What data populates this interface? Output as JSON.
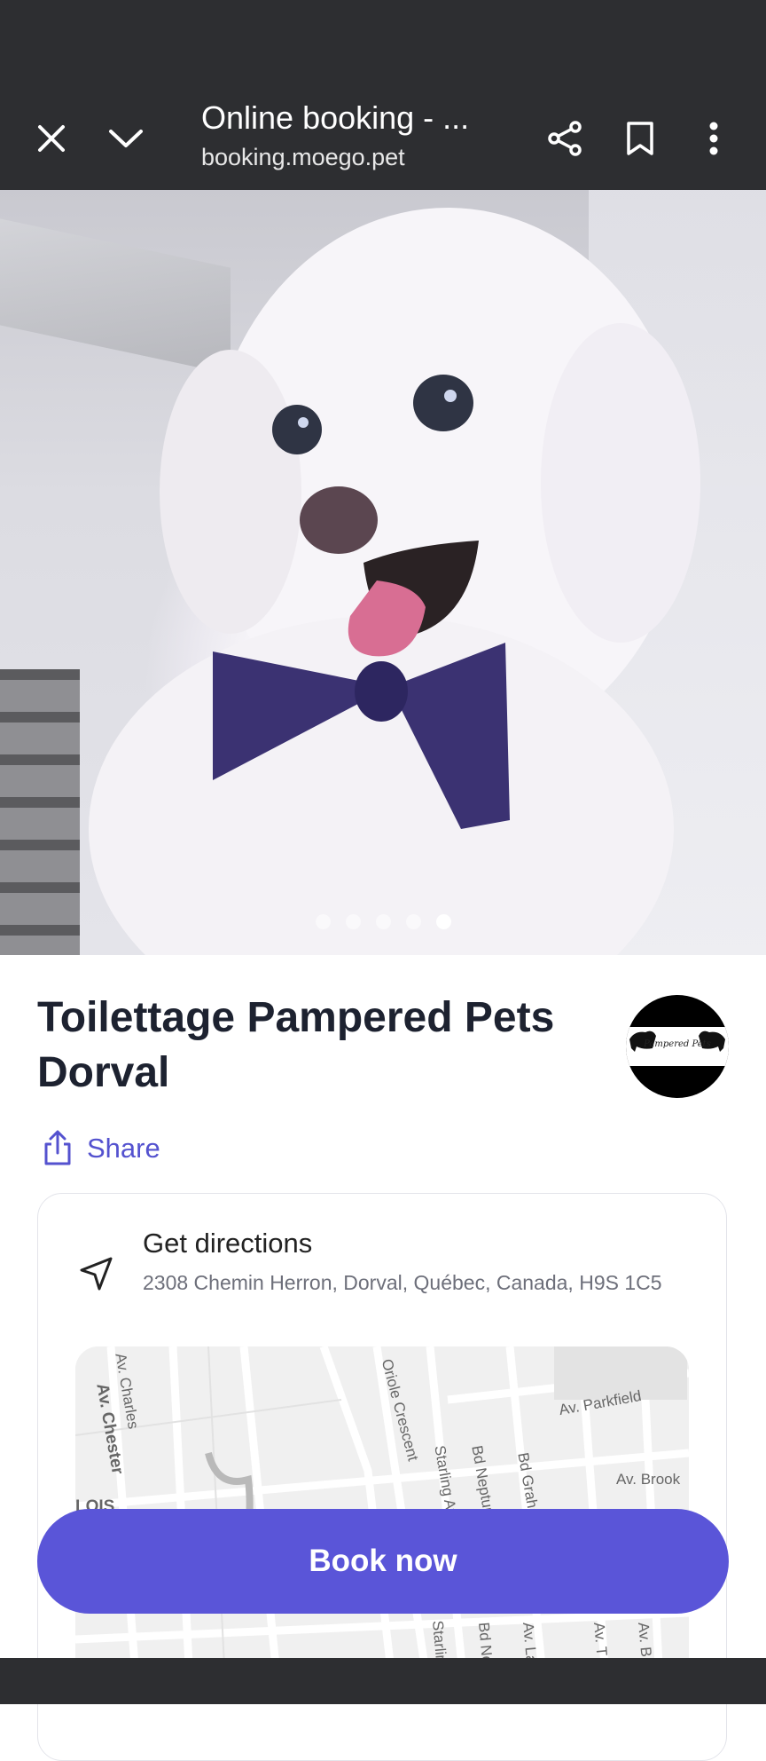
{
  "browser": {
    "title": "Online booking - ...",
    "url": "booking.moego.pet"
  },
  "carousel": {
    "count": 5,
    "active_index": 4
  },
  "business": {
    "name": "Toilettage Pampered Pets Dorval",
    "logo_text": "Pampered Pets"
  },
  "share": {
    "label": "Share"
  },
  "directions": {
    "title": "Get directions",
    "address": "2308 Chemin Herron, Dorval, Québec, Canada, H9S 1C5"
  },
  "map": {
    "labels": [
      "Av. Charles",
      "Av. Chester",
      "Oriole Crescent",
      "Av. Parkfield",
      "Av. Brook",
      "Starling Ave",
      "Bd Neptune",
      "Bd Graham",
      "LOIS",
      "Starling",
      "Bd Ne",
      "Av. La",
      "Av. T",
      "Av. B"
    ]
  },
  "actions": {
    "book_label": "Book now"
  },
  "colors": {
    "accent": "#5a55d8",
    "toolbar": "#2d2e31"
  }
}
